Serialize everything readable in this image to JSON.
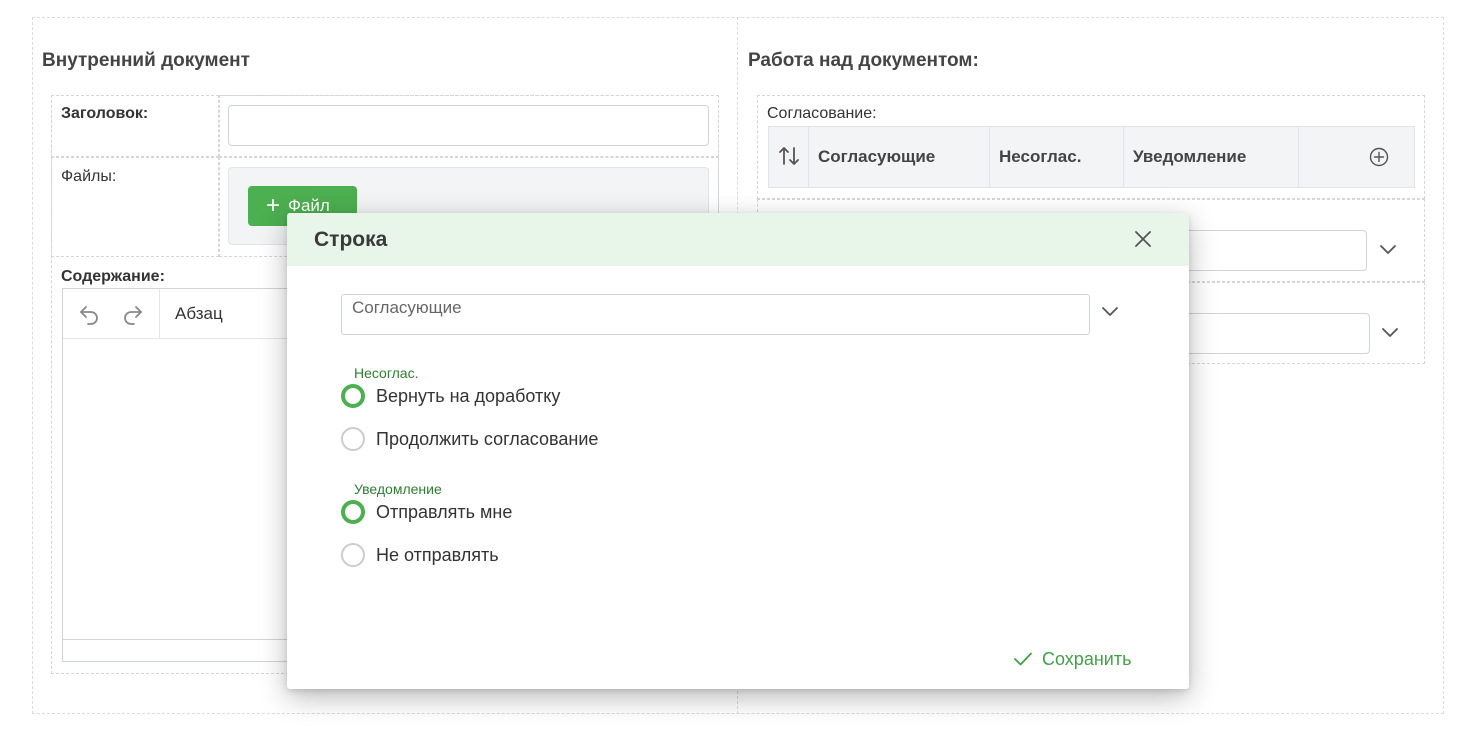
{
  "left_panel": {
    "title": "Внутренний документ",
    "fields": {
      "heading_label": "Заголовок:",
      "heading_value": "",
      "files_label": "Файлы:",
      "add_file_label": "Файл",
      "content_label": "Содержание:"
    },
    "editor": {
      "block_format": "Абзац"
    }
  },
  "right_panel": {
    "title": "Работа над документом:",
    "approval_label": "Согласование:",
    "table_columns": [
      "Согласующие",
      "Несоглас.",
      "Уведомление"
    ]
  },
  "modal": {
    "title": "Строка",
    "approvers_placeholder": "Согласующие",
    "disagreement": {
      "label": "Несоглас.",
      "options": [
        "Вернуть на доработку",
        "Продолжить согласование"
      ],
      "selected": 0
    },
    "notification": {
      "label": "Уведомление",
      "options": [
        "Отправлять мне",
        "Не отправлять"
      ],
      "selected": 0
    },
    "save_label": "Сохранить"
  },
  "colors": {
    "accent_green": "#4caf50",
    "header_green": "#e8f5e9",
    "label_green": "#2e7d32"
  }
}
